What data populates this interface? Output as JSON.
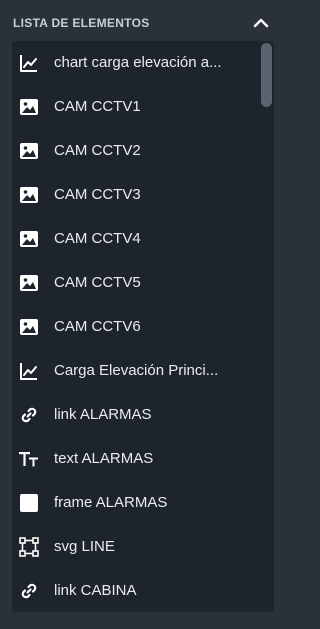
{
  "header": {
    "title": "LISTA DE ELEMENTOS",
    "collapse_icon": "chevron-up-icon"
  },
  "items": [
    {
      "label": "chart carga elevación a...",
      "icon": "chart-line-icon"
    },
    {
      "label": "CAM CCTV1",
      "icon": "image-icon"
    },
    {
      "label": "CAM CCTV2",
      "icon": "image-icon"
    },
    {
      "label": "CAM CCTV3",
      "icon": "image-icon"
    },
    {
      "label": "CAM CCTV4",
      "icon": "image-icon"
    },
    {
      "label": "CAM CCTV5",
      "icon": "image-icon"
    },
    {
      "label": "CAM CCTV6",
      "icon": "image-icon"
    },
    {
      "label": "Carga Elevación Princi...",
      "icon": "chart-line-icon"
    },
    {
      "label": "link ALARMAS",
      "icon": "link-icon"
    },
    {
      "label": "text ALARMAS",
      "icon": "text-icon"
    },
    {
      "label": "frame ALARMAS",
      "icon": "frame-icon"
    },
    {
      "label": "svg LINE",
      "icon": "vector-square-icon"
    },
    {
      "label": "link CABINA",
      "icon": "link-icon"
    }
  ],
  "colors": {
    "panel_bg": "#2b3139",
    "list_bg": "#1e242c",
    "text": "#e8ecf0",
    "header_text": "#c9cfd6",
    "scrollbar": "#5a6470"
  }
}
